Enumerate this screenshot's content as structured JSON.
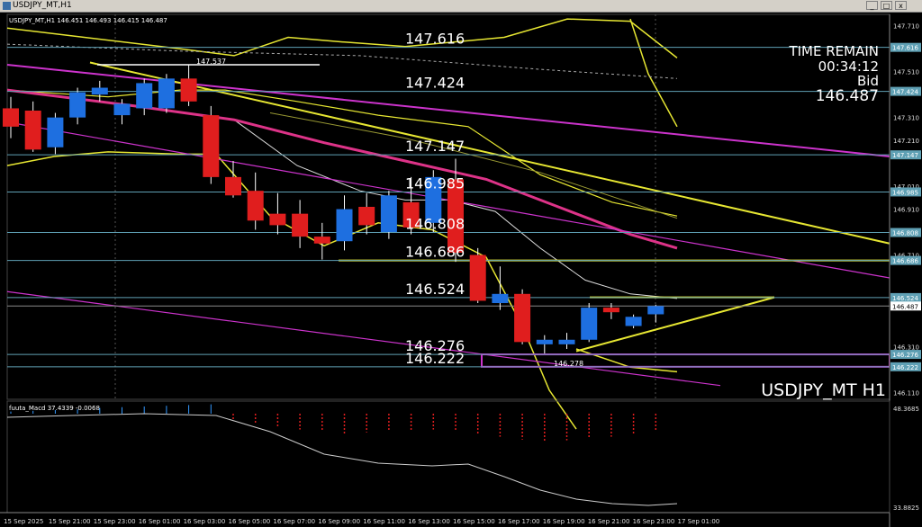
{
  "window": {
    "title": "USDJPY_MT,H1",
    "minimize_label": "_",
    "restore_label": "□",
    "close_label": "x"
  },
  "header": {
    "info": "USDJPY_MT,H1  146.451 146.493 146.415 146.487"
  },
  "overlay": {
    "time_remain_label": "TIME REMAIN",
    "time_remain_value": "00:34:12",
    "bid_label": "Bid",
    "bid_value": "146.487",
    "symbol_label": "USDJPY_MT H1",
    "marker_high": "147.537",
    "marker_low": "146.278"
  },
  "colors": {
    "bull": "#1e6fe0",
    "bear": "#e01e1e",
    "yellow": "#e6e632",
    "magenta": "#cc33cc",
    "level_line": "#5fa0b4",
    "white": "#ffffff"
  },
  "macd": {
    "label": "fuuta_Macd 37.4339 -0.0068",
    "ticks": [
      "48.3685",
      "33.8825"
    ]
  },
  "chart_data": {
    "type": "candlestick",
    "symbol": "USDJPY_MT",
    "timeframe": "H1",
    "ylim": [
      146.08,
      147.76
    ],
    "y_ticks": [
      "147.710",
      "147.510",
      "147.310",
      "147.210",
      "147.010",
      "146.910",
      "146.710",
      "146.510",
      "146.310",
      "146.110"
    ],
    "x_ticks": [
      "15 Sep 2025",
      "15 Sep 21:00",
      "15 Sep 23:00",
      "16 Sep 01:00",
      "16 Sep 03:00",
      "16 Sep 05:00",
      "16 Sep 07:00",
      "16 Sep 09:00",
      "16 Sep 11:00",
      "16 Sep 13:00",
      "16 Sep 15:00",
      "16 Sep 17:00",
      "16 Sep 19:00",
      "16 Sep 21:00",
      "16 Sep 23:00",
      "17 Sep 01:00"
    ],
    "levels": [
      {
        "value": 147.616,
        "label": "147.616"
      },
      {
        "value": 147.424,
        "label": "147.424"
      },
      {
        "value": 147.147,
        "label": "147.147"
      },
      {
        "value": 146.985,
        "label": "146.985"
      },
      {
        "value": 146.808,
        "label": "146.808"
      },
      {
        "value": 146.686,
        "label": "146.686"
      },
      {
        "value": 146.524,
        "label": "146.524"
      },
      {
        "value": 146.276,
        "label": "146.276"
      },
      {
        "value": 146.222,
        "label": "146.222"
      }
    ],
    "current_price": {
      "value": 146.487,
      "label": "146.487"
    },
    "candles": [
      {
        "o": 147.35,
        "h": 147.4,
        "l": 147.22,
        "c": 147.27
      },
      {
        "o": 147.34,
        "h": 147.38,
        "l": 147.16,
        "c": 147.17
      },
      {
        "o": 147.18,
        "h": 147.33,
        "l": 147.15,
        "c": 147.31
      },
      {
        "o": 147.31,
        "h": 147.44,
        "l": 147.28,
        "c": 147.42
      },
      {
        "o": 147.41,
        "h": 147.47,
        "l": 147.38,
        "c": 147.44
      },
      {
        "o": 147.32,
        "h": 147.39,
        "l": 147.28,
        "c": 147.37
      },
      {
        "o": 147.35,
        "h": 147.48,
        "l": 147.32,
        "c": 147.46
      },
      {
        "o": 147.35,
        "h": 147.5,
        "l": 147.33,
        "c": 147.48
      },
      {
        "o": 147.48,
        "h": 147.54,
        "l": 147.36,
        "c": 147.38
      },
      {
        "o": 147.32,
        "h": 147.36,
        "l": 147.02,
        "c": 147.05
      },
      {
        "o": 147.05,
        "h": 147.12,
        "l": 146.96,
        "c": 146.97
      },
      {
        "o": 146.99,
        "h": 147.07,
        "l": 146.82,
        "c": 146.86
      },
      {
        "o": 146.89,
        "h": 146.98,
        "l": 146.8,
        "c": 146.84
      },
      {
        "o": 146.89,
        "h": 146.95,
        "l": 146.74,
        "c": 146.79
      },
      {
        "o": 146.79,
        "h": 146.85,
        "l": 146.69,
        "c": 146.76
      },
      {
        "o": 146.77,
        "h": 146.97,
        "l": 146.73,
        "c": 146.91
      },
      {
        "o": 146.92,
        "h": 146.98,
        "l": 146.8,
        "c": 146.84
      },
      {
        "o": 146.81,
        "h": 146.99,
        "l": 146.78,
        "c": 146.97
      },
      {
        "o": 146.94,
        "h": 147.05,
        "l": 146.8,
        "c": 146.83
      },
      {
        "o": 146.85,
        "h": 147.08,
        "l": 146.81,
        "c": 147.05
      },
      {
        "o": 147.04,
        "h": 147.13,
        "l": 146.68,
        "c": 146.72
      },
      {
        "o": 146.71,
        "h": 146.74,
        "l": 146.5,
        "c": 146.51
      },
      {
        "o": 146.5,
        "h": 146.66,
        "l": 146.47,
        "c": 146.54
      },
      {
        "o": 146.54,
        "h": 146.56,
        "l": 146.32,
        "c": 146.33
      },
      {
        "o": 146.32,
        "h": 146.36,
        "l": 146.28,
        "c": 146.34
      },
      {
        "o": 146.32,
        "h": 146.37,
        "l": 146.3,
        "c": 146.34
      },
      {
        "o": 146.34,
        "h": 146.5,
        "l": 146.33,
        "c": 146.48
      },
      {
        "o": 146.48,
        "h": 146.5,
        "l": 146.43,
        "c": 146.46
      },
      {
        "o": 146.4,
        "h": 146.45,
        "l": 146.39,
        "c": 146.44
      },
      {
        "o": 146.451,
        "h": 146.493,
        "l": 146.415,
        "c": 146.487
      }
    ]
  }
}
